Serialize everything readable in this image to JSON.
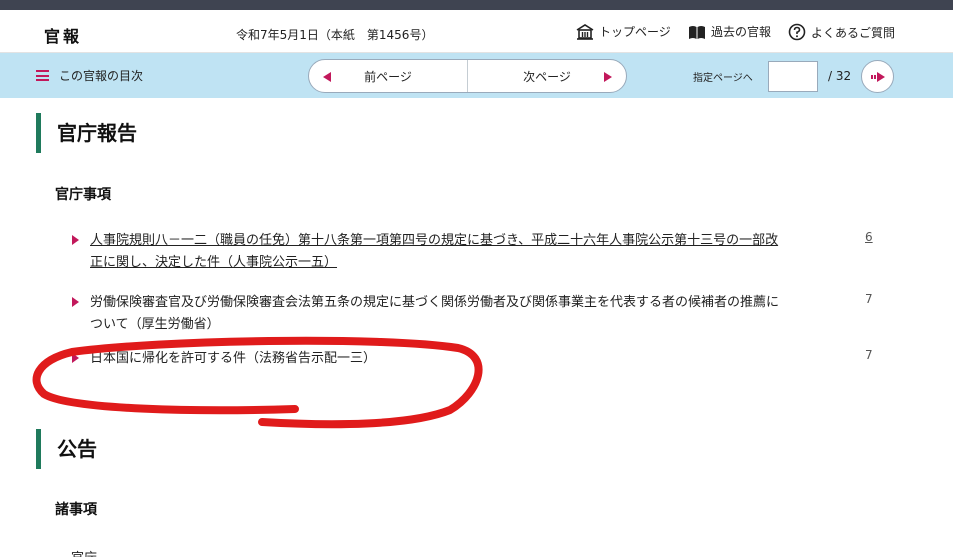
{
  "header": {
    "logo": "官報",
    "issue": "令和7年5月1日（本紙　第1456号）",
    "links": [
      {
        "label": "トップページ",
        "icon": "home-icon"
      },
      {
        "label": "過去の官報",
        "icon": "book-icon"
      },
      {
        "label": "よくあるご質問",
        "icon": "help-icon"
      }
    ]
  },
  "navbar": {
    "toc_label": "この官報の目次",
    "prev_label": "前ページ",
    "next_label": "次ページ",
    "jump_label": "指定ページへ",
    "jump_value": "",
    "total_pages": "/ 32"
  },
  "sections": [
    {
      "title": "官庁報告",
      "subsections": [
        {
          "title": "官庁事項",
          "entries": [
            {
              "text": "人事院規則八－一二（職員の任免）第十八条第一項第四号の規定に基づき、平成二十六年人事院公示第十三号の一部改正に関し、決定した件（人事院公示一五）",
              "page": "6",
              "linked": true
            },
            {
              "text": "労働保険審査官及び労働保険審査会法第五条の規定に基づく関係労働者及び関係事業主を代表する者の候補者の推薦について（厚生労働省）",
              "page": "7",
              "linked": false
            },
            {
              "text": "日本国に帰化を許可する件（法務省告示配一三）",
              "page": "7",
              "linked": false
            }
          ]
        }
      ]
    },
    {
      "title": "公告",
      "subsections": [
        {
          "title": "諸事項",
          "entries": []
        }
      ]
    }
  ],
  "partial_next": "官庁",
  "colors": {
    "accent": "#c2185b",
    "section_bar": "#1f7a5c",
    "navbar_bg": "#bfe3f3",
    "top_strip": "#3f4451",
    "annotation": "#e01b1b"
  }
}
